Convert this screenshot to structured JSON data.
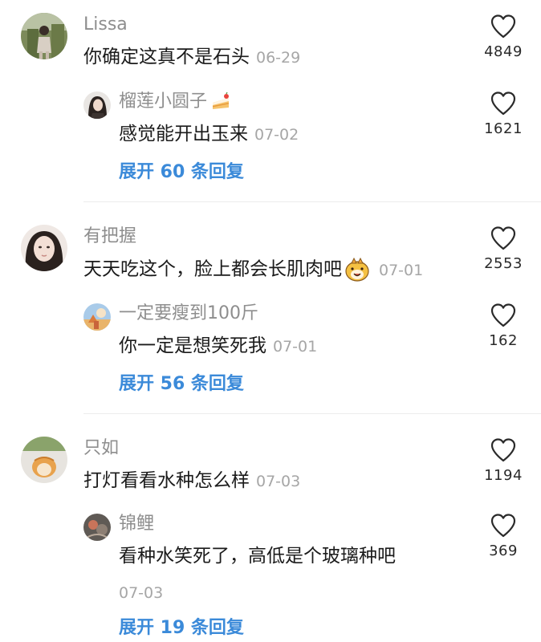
{
  "comments": [
    {
      "user": "Lissa",
      "text": "你确定这真不是石头",
      "date": "06-29",
      "likes": "4849",
      "reply": {
        "user": "榴莲小圆子",
        "text": "感觉能开出玉来",
        "date": "07-02",
        "likes": "1621"
      },
      "expand": "展开 60 条回复"
    },
    {
      "user": "有把握",
      "text": "天天吃这个，脸上都会长肌肉吧",
      "date": "07-01",
      "likes": "2553",
      "reply": {
        "user": "一定要瘦到100斤",
        "text": "你一定是想笑死我",
        "date": "07-01",
        "likes": "162"
      },
      "expand": "展开 56 条回复"
    },
    {
      "user": "只如",
      "text": "打灯看看水种怎么样",
      "date": "07-03",
      "likes": "1194",
      "reply": {
        "user": "锦鲤",
        "text": "看种水笑死了，高低是个玻璃种吧",
        "date": "07-03",
        "likes": "369"
      },
      "expand": "展开 19 条回复"
    }
  ],
  "icons": {
    "like": "heart-outline-icon",
    "cake_emoji": "cake-icon",
    "face_emoji": "grinning-dog-emoji-icon"
  },
  "colors": {
    "link": "#3b8ad9",
    "username": "#8e8e8e",
    "date": "#a6a6a6"
  }
}
